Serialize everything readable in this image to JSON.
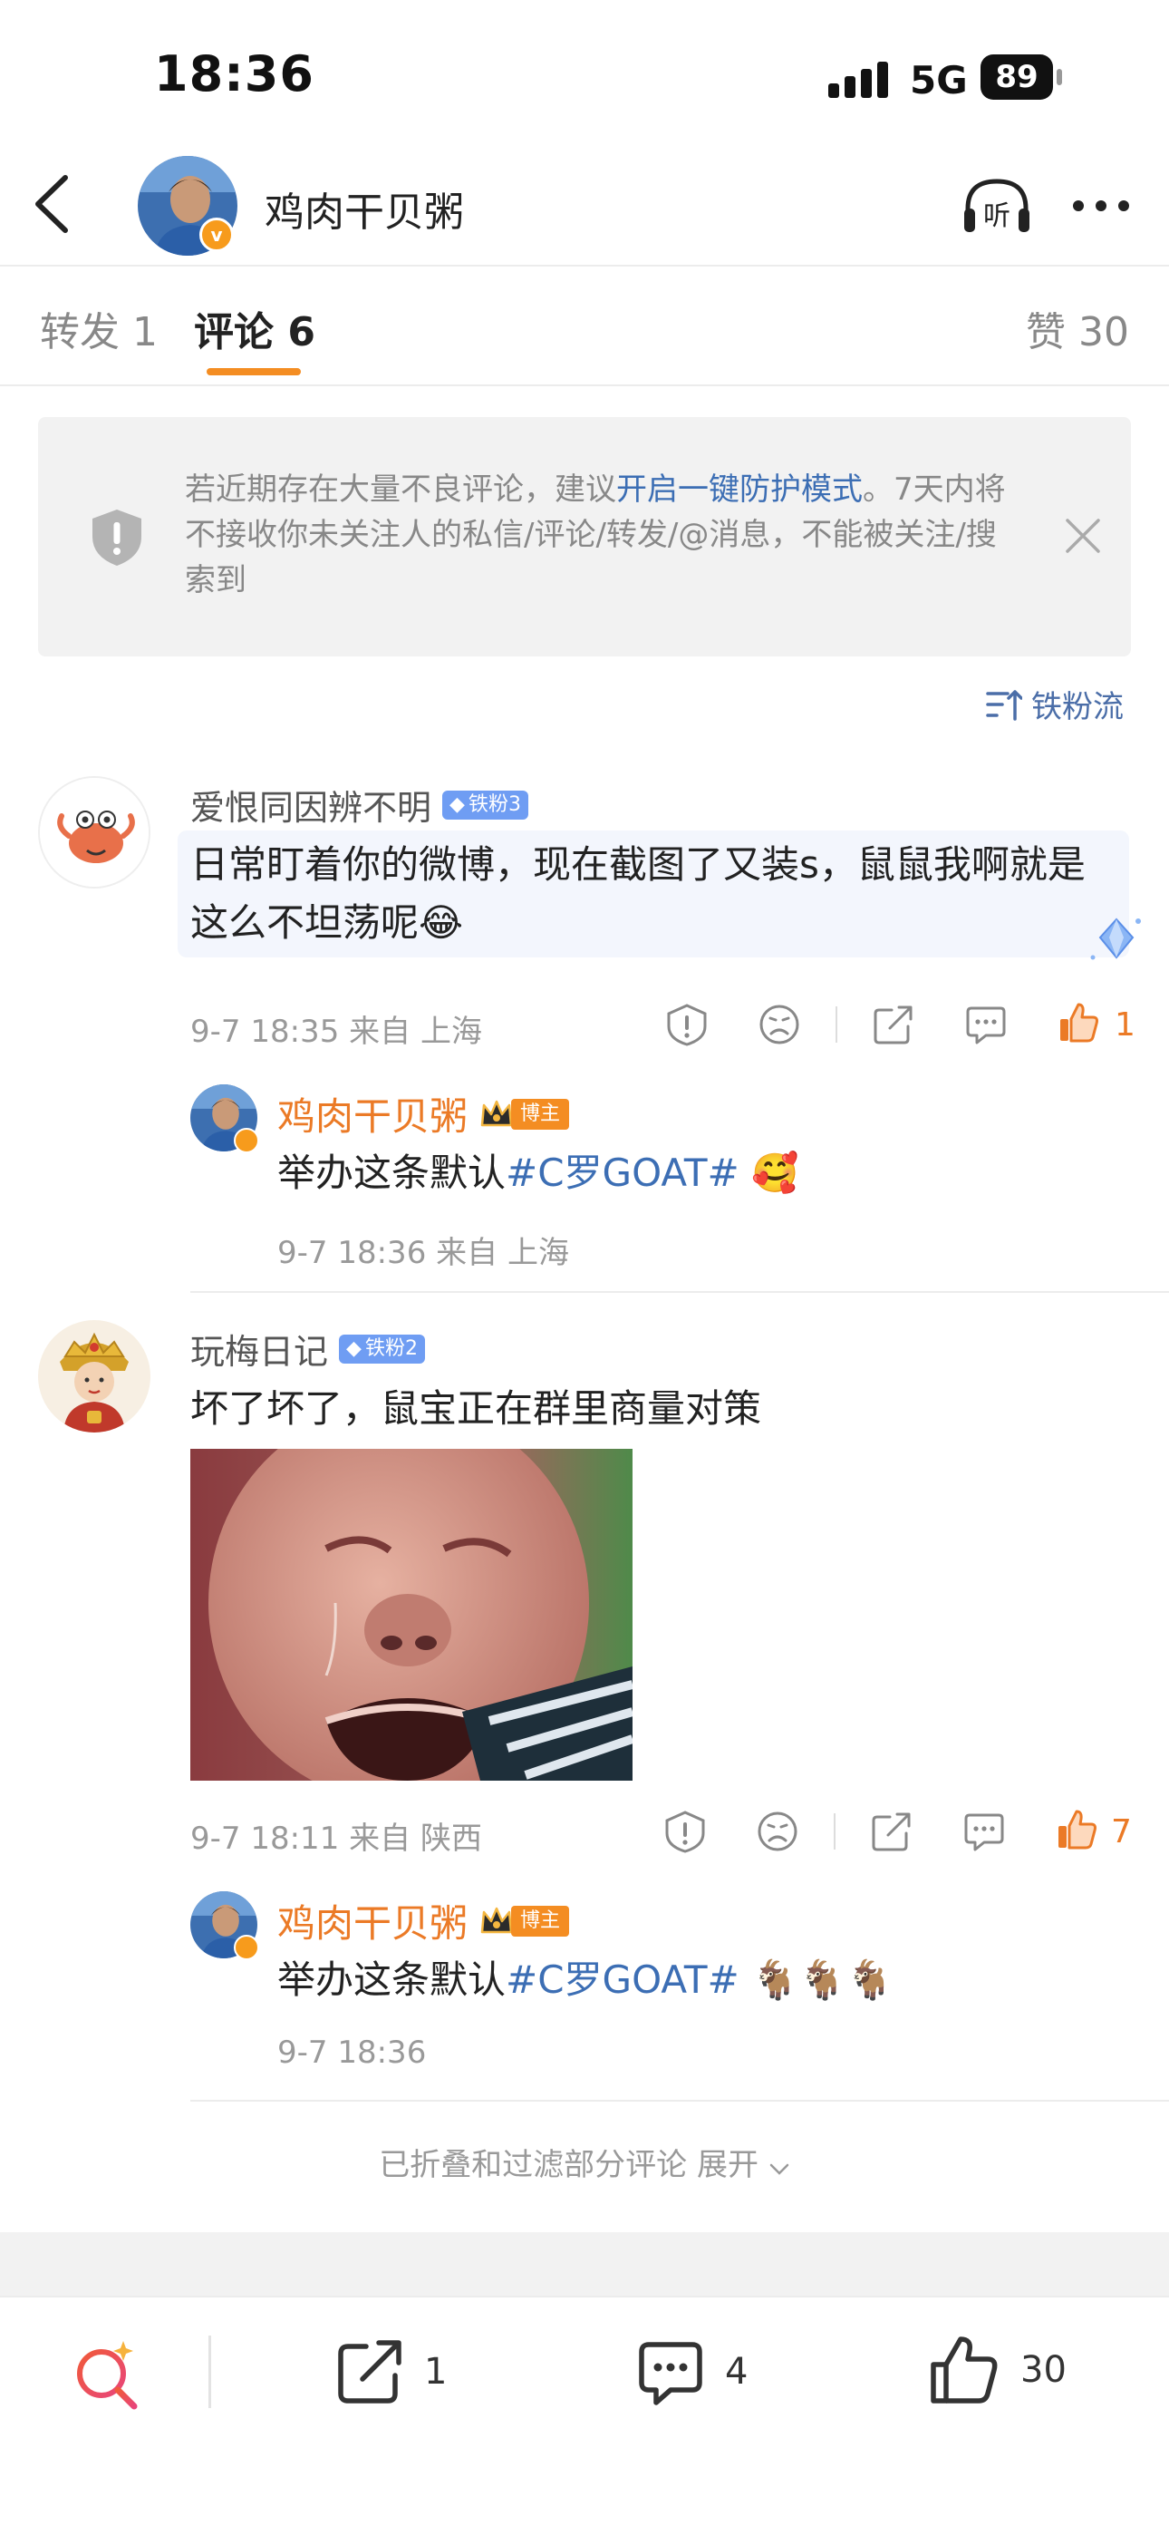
{
  "status_bar": {
    "time": "18:36",
    "network": "5G",
    "battery": "89"
  },
  "header": {
    "title": "鸡肉干贝粥",
    "listen_label": "听",
    "verified": "v"
  },
  "tabs": [
    {
      "label": "转发 1"
    },
    {
      "label": "评论 6"
    },
    {
      "label": "赞 30"
    }
  ],
  "notice": {
    "text_before": "若近期存在大量不良评论，建议",
    "link": "开启一键防护模式",
    "text_after": "。7天内将不接收你未关注人的私信/评论/转发/@消息，不能被关注/搜索到"
  },
  "sort_label": "铁粉流",
  "comments": [
    {
      "user": "爱恨同因辨不明",
      "fan_badge": "铁粉3",
      "text": "日常盯着你的微博，现在截图了又装s，鼠鼠我啊就是这么不坦荡呢",
      "emoji": "😂",
      "time": "9-7 18:35",
      "location": "来自 上海",
      "likes": "1",
      "reply": {
        "user": "鸡肉干贝粥",
        "badge": "博主",
        "text": "举办这条默认",
        "topic": "#C罗GOAT#",
        "emoji": "🥰",
        "time": "9-7 18:36",
        "location": "来自 上海"
      }
    },
    {
      "user": "玩梅日记",
      "fan_badge": "铁粉2",
      "text": "坏了坏了，鼠宝正在群里商量对策",
      "time": "9-7 18:11",
      "location": "来自 陕西",
      "likes": "7",
      "reply": {
        "user": "鸡肉干贝粥",
        "badge": "博主",
        "text": "举办这条默认",
        "topic": "#C罗GOAT#",
        "emoji": "🐐🐐🐐",
        "time": "9-7 18:36"
      }
    }
  ],
  "folded_label": "已折叠和过滤部分评论 展开",
  "bottom_bar": {
    "repost_count": "1",
    "comment_count": "4",
    "like_count": "30"
  },
  "colors": {
    "accent": "#f48d22",
    "link": "#3c6eb4",
    "fan_badge": "#6f9df3"
  }
}
